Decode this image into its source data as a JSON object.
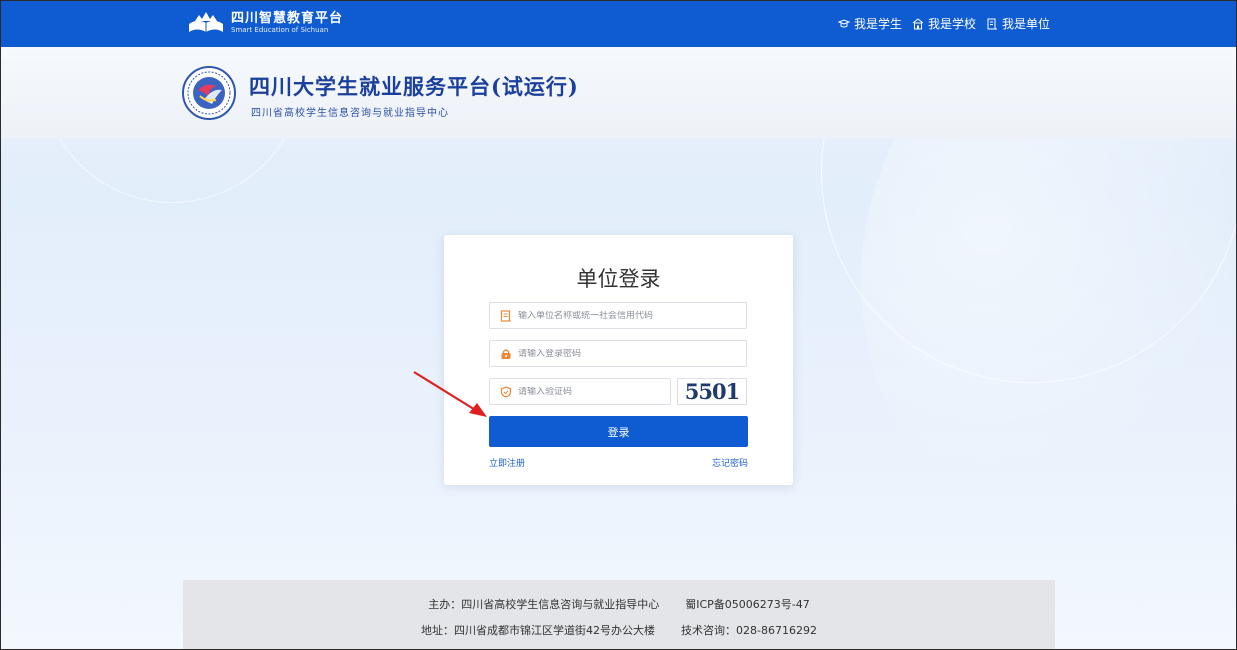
{
  "topbar": {
    "logo_cn": "四川智慧教育平台",
    "logo_en": "Smart Education of Sichuan",
    "links": [
      {
        "label": "我是学生",
        "icon": "graduation-cap-icon"
      },
      {
        "label": "我是学校",
        "icon": "school-icon"
      },
      {
        "label": "我是单位",
        "icon": "building-icon"
      }
    ]
  },
  "banner": {
    "title": "四川大学生就业服务平台(试运行)",
    "subtitle": "四川省高校学生信息咨询与就业指导中心"
  },
  "login": {
    "title": "单位登录",
    "username_placeholder": "输入单位名称或统一社会信用代码",
    "password_placeholder": "请输入登录密码",
    "captcha_placeholder": "请输入验证码",
    "captcha_text": "5501",
    "submit_label": "登录",
    "register_link": "立即注册",
    "forgot_link": "忘记密码"
  },
  "footer": {
    "host": "主办：四川省高校学生信息咨询与就业指导中心",
    "icp": "蜀ICP备05006273号-47",
    "address": "地址：四川省成都市锦江区学道街42号办公大楼",
    "tech": "技术咨询：028-86716292"
  },
  "colors": {
    "primary": "#0f5bd1",
    "title_blue": "#1b3f9c",
    "icon_orange": "#e8893a",
    "annotation_red": "#e02020"
  }
}
